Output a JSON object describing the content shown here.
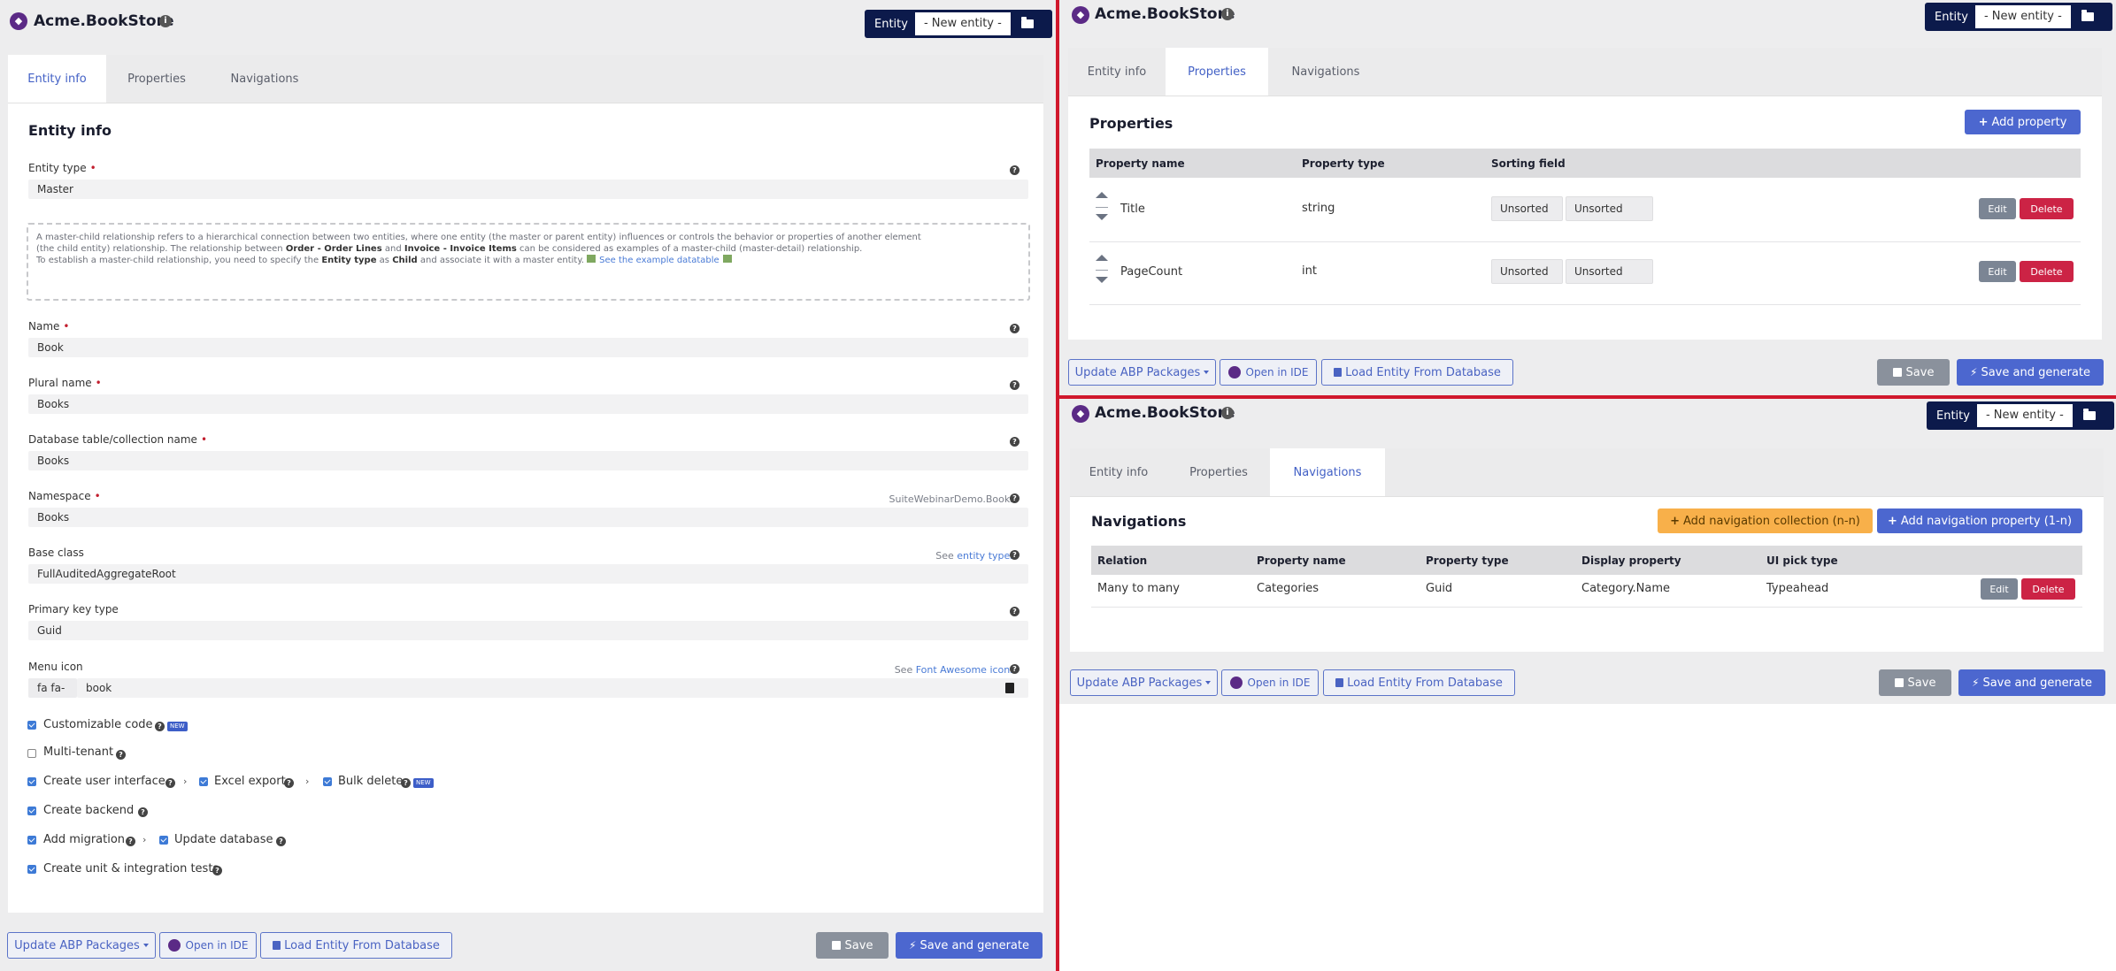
{
  "app": {
    "title": "Acme.BookStore",
    "logo_icon": "visual-studio-logo-icon"
  },
  "entity_selector": {
    "label": "Entity",
    "value": "- New entity -",
    "icon": "folder-open-icon"
  },
  "tabs": {
    "entity_info": "Entity info",
    "properties": "Properties",
    "navigations": "Navigations"
  },
  "entity_info": {
    "title": "Entity info",
    "entity_type": {
      "label": "Entity type",
      "value": "Master"
    },
    "info_box": {
      "line1_a": "A master-child relationship refers to a hierarchical connection between two entities, where one entity (the master or parent entity) influences or controls the behavior or properties of another element",
      "line2_a": "(the child entity) relationship. The relationship between ",
      "line2_b": "Order - Order Lines",
      "line2_c": " and ",
      "line2_d": "Invoice - Invoice Items",
      "line2_e": " can be considered as examples of a master-child (master-detail) relationship.",
      "line3_a": "To establish a master-child relationship, you need to specify the ",
      "line3_b": "Entity type",
      "line3_c": " as ",
      "line3_d": "Child",
      "line3_e": " and associate it with a master entity. ",
      "link": "See the example datatable"
    },
    "name": {
      "label": "Name",
      "value": "Book"
    },
    "plural_name": {
      "label": "Plural name",
      "value": "Books"
    },
    "db_table": {
      "label": "Database table/collection name",
      "value": "Books"
    },
    "namespace": {
      "label": "Namespace",
      "value": "Books",
      "hint": "SuiteWebinarDemo.Books"
    },
    "base_class": {
      "label": "Base class",
      "value": "FullAuditedAggregateRoot",
      "hint_prefix": "See ",
      "hint_link": "entity types"
    },
    "primary_key": {
      "label": "Primary key type",
      "value": "Guid"
    },
    "menu_icon": {
      "label": "Menu icon",
      "prefix": "fa fa-",
      "value": "book",
      "hint_prefix": "See ",
      "hint_link": "Font Awesome icons"
    },
    "checkboxes": {
      "customizable_code": "Customizable code",
      "multi_tenant": "Multi-tenant",
      "create_ui": "Create user interface",
      "excel_export": "Excel export",
      "bulk_delete": "Bulk delete",
      "create_backend": "Create backend",
      "add_migration": "Add migration",
      "update_database": "Update database",
      "create_tests": "Create unit & integration tests",
      "new_badge": "NEW"
    }
  },
  "properties": {
    "title": "Properties",
    "add_button": "Add property",
    "columns": [
      "Property name",
      "Property type",
      "Sorting field"
    ],
    "rows": [
      {
        "name": "Title",
        "type": "string",
        "sort1": "Unsorted",
        "sort2": "Unsorted"
      },
      {
        "name": "PageCount",
        "type": "int",
        "sort1": "Unsorted",
        "sort2": "Unsorted"
      }
    ],
    "edit_label": "Edit",
    "delete_label": "Delete"
  },
  "navigations": {
    "title": "Navigations",
    "add_collection_button": "Add navigation collection (n-n)",
    "add_property_button": "Add navigation property (1-n)",
    "columns": [
      "Relation",
      "Property name",
      "Property type",
      "Display property",
      "UI pick type"
    ],
    "rows": [
      {
        "relation": "Many to many",
        "property_name": "Categories",
        "property_type": "Guid",
        "display_property": "Category.Name",
        "ui_pick_type": "Typeahead"
      }
    ],
    "edit_label": "Edit",
    "delete_label": "Delete"
  },
  "footer": {
    "update_abp": "Update ABP Packages",
    "open_ide": "Open in IDE",
    "load_entity": "Load Entity From Database",
    "save": "Save",
    "save_generate": "Save and generate"
  },
  "colors": {
    "accent": "#4c67cf",
    "navy": "#0c1a4b",
    "danger": "#cc2345",
    "warning": "#f8b04a",
    "divider": "#d0182c"
  }
}
